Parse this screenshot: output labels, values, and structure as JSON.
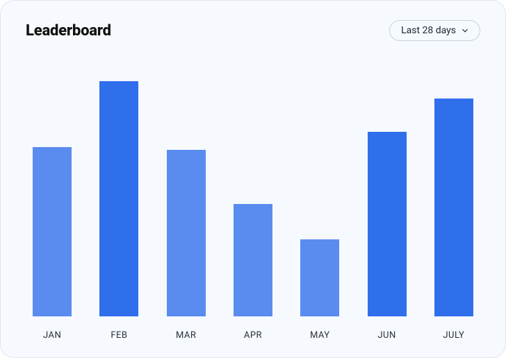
{
  "header": {
    "title": "Leaderboard",
    "range_label": "Last 28 days"
  },
  "chart_data": {
    "type": "bar",
    "categories": [
      "JAN",
      "FEB",
      "MAR",
      "APR",
      "MAY",
      "JUN",
      "JULY"
    ],
    "values": [
      66,
      92,
      65,
      44,
      30,
      72,
      85
    ],
    "title": "Leaderboard",
    "xlabel": "",
    "ylabel": "",
    "ylim": [
      0,
      100
    ],
    "series_colors": [
      "#5A8CF0",
      "#2F6FEC",
      "#5A8CF0",
      "#5A8CF0",
      "#5A8CF0",
      "#2F6FEC",
      "#2F6FEC"
    ]
  }
}
